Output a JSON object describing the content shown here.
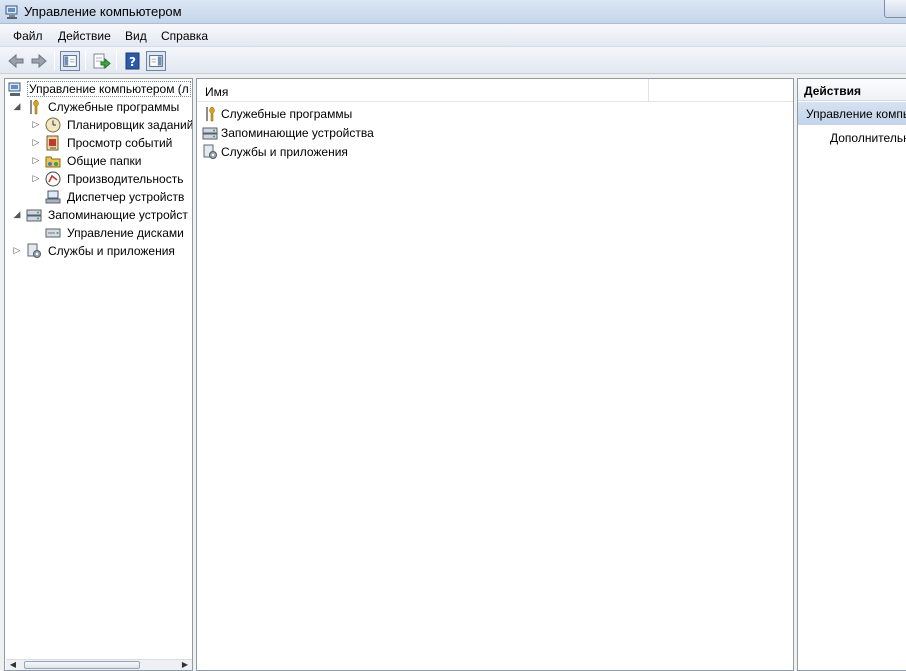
{
  "window": {
    "title": "Управление компьютером"
  },
  "menu": {
    "items": [
      "Файл",
      "Действие",
      "Вид",
      "Справка"
    ]
  },
  "toolbar": {
    "buttons": [
      "back-icon",
      "forward-icon",
      "show-hide-tree-icon",
      "export-list-icon",
      "help-icon",
      "show-hide-action-pane-icon"
    ]
  },
  "tree": {
    "items": [
      {
        "label": "Управление компьютером (л",
        "icon": "computer-management-icon"
      },
      {
        "label": "Служебные программы",
        "icon": "tools-icon"
      },
      {
        "label": "Планировщик заданий",
        "icon": "clock-icon"
      },
      {
        "label": "Просмотр событий",
        "icon": "event-viewer-icon"
      },
      {
        "label": "Общие папки",
        "icon": "shared-folders-icon"
      },
      {
        "label": "Производительность",
        "icon": "performance-icon"
      },
      {
        "label": "Диспетчер устройств",
        "icon": "device-manager-icon"
      },
      {
        "label": "Запоминающие устройст",
        "icon": "storage-icon"
      },
      {
        "label": "Управление дисками",
        "icon": "disk-management-icon"
      },
      {
        "label": "Службы и приложения",
        "icon": "services-icon"
      }
    ]
  },
  "list": {
    "column_header": "Имя",
    "items": [
      {
        "label": "Служебные программы",
        "icon": "tools-icon"
      },
      {
        "label": "Запоминающие устройства",
        "icon": "storage-icon"
      },
      {
        "label": "Службы и приложения",
        "icon": "services-icon"
      }
    ]
  },
  "actions": {
    "title": "Действия",
    "section": "Управление компь",
    "item": "Дополнительные"
  },
  "colors": {
    "selection": "#c3d4ea",
    "pane_border": "#8f9aa8",
    "titlebar": "#dbe6f4"
  }
}
